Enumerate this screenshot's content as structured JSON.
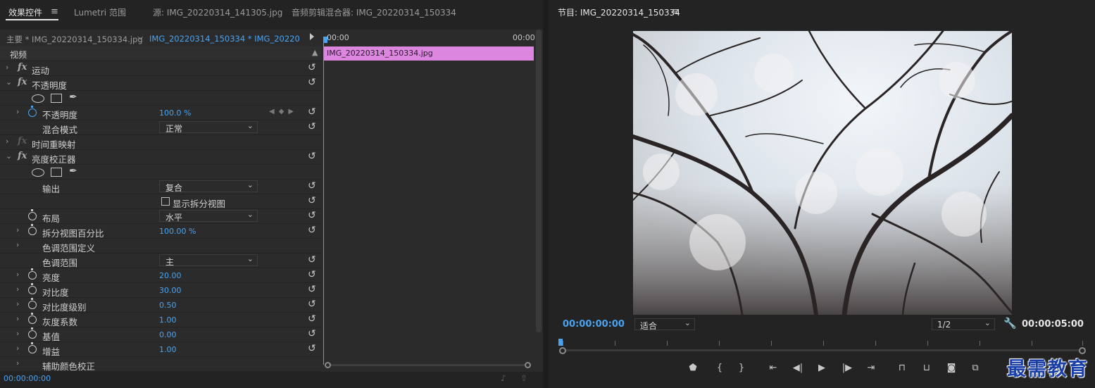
{
  "left_panel": {
    "tabs": [
      {
        "label": "效果控件",
        "active": true
      },
      {
        "label": "Lumetri 范围",
        "active": false
      },
      {
        "label": "源: IMG_20220314_141305.jpg",
        "active": false
      },
      {
        "label": "音频剪辑混合器: IMG_20220314_150334",
        "active": false
      }
    ],
    "menu_icon": "≡",
    "header": {
      "source_label": "主要 * IMG_20220314_150334.jpg",
      "clip_label": "IMG_20220314_150334 * IMG_20220314..."
    },
    "section_title": "视频",
    "rows": [
      {
        "label": "运动"
      },
      {
        "label": "不透明度"
      },
      {
        "label": "不透明度",
        "value": "100.0 %"
      },
      {
        "label": "混合模式",
        "dropdown": "正常"
      },
      {
        "label": "时间重映射"
      },
      {
        "label": "亮度校正器"
      },
      {
        "label": "输出",
        "dropdown": "复合"
      },
      {
        "label": "显示拆分视图"
      },
      {
        "label": "布局",
        "dropdown": "水平"
      },
      {
        "label": "拆分视图百分比",
        "value": "100.00 %"
      },
      {
        "label": "色调范围定义"
      },
      {
        "label": "色调范围",
        "dropdown": "主"
      },
      {
        "label": "亮度",
        "value": "20.00"
      },
      {
        "label": "对比度",
        "value": "30.00"
      },
      {
        "label": "对比度级别",
        "value": "0.50"
      },
      {
        "label": "灰度系数",
        "value": "1.00"
      },
      {
        "label": "基值",
        "value": "0.00"
      },
      {
        "label": "增益",
        "value": "1.00"
      },
      {
        "label": "辅助颜色校正"
      }
    ],
    "timeline": {
      "start_tc": "00:00",
      "end_tc": "00:00",
      "clip_name": "IMG_20220314_150334.jpg",
      "clip_color": "#dc86e0"
    },
    "footer_timecode": "00:00:00:00"
  },
  "program_monitor": {
    "title": "节目: IMG_20220314_150334",
    "menu_icon": "≡",
    "timecode": "00:00:00:00",
    "fit_select": "适合",
    "resolution_select": "1/2",
    "duration": "00:00:05:00",
    "wrench_icon": "wrench-icon"
  },
  "watermark": "最需教育",
  "colors": {
    "accent_blue": "#4aa3f0",
    "panel_bg": "#232323",
    "clip_pink": "#dc86e0",
    "watermark_blue": "#1a3fa8"
  }
}
